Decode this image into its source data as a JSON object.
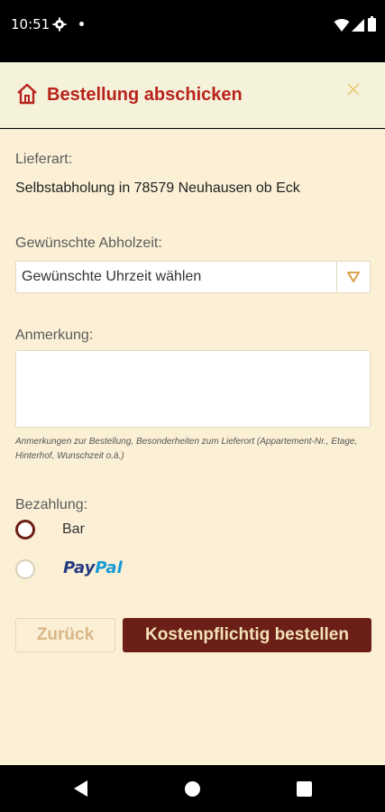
{
  "status_bar": {
    "time": "10:51",
    "icons": [
      "gear-icon",
      "notification-dot",
      "wifi-icon",
      "signal-icon",
      "battery-icon"
    ]
  },
  "header": {
    "title": "Bestellung abschicken",
    "icon": "home-icon",
    "close_icon": "close-icon"
  },
  "delivery": {
    "label": "Lieferart:",
    "value": "Selbstabholung in 78579 Neuhausen ob Eck"
  },
  "pickup_time": {
    "label": "Gewünschte Abholzeit:",
    "selected": "Gewünschte Uhrzeit wählen"
  },
  "note": {
    "label": "Anmerkung:",
    "value": "",
    "hint": "Anmerkungen zur Bestellung, Besonderheiten zum Lieferort (Appartement-Nr., Etage, Hinterhof, Wunschzeit o.ä.)"
  },
  "payment": {
    "label": "Bezahlung:",
    "options": [
      {
        "label": "Bar",
        "checked": true
      },
      {
        "label_part1": "Pay",
        "label_part2": "Pal",
        "checked": false
      }
    ]
  },
  "buttons": {
    "back": "Zurück",
    "order": "Kostenpflichtig bestellen"
  },
  "colors": {
    "accent": "#b8231c",
    "primary_button": "#6b1f16",
    "background": "#fbf0d6",
    "header_bg": "#f5f2dc"
  }
}
